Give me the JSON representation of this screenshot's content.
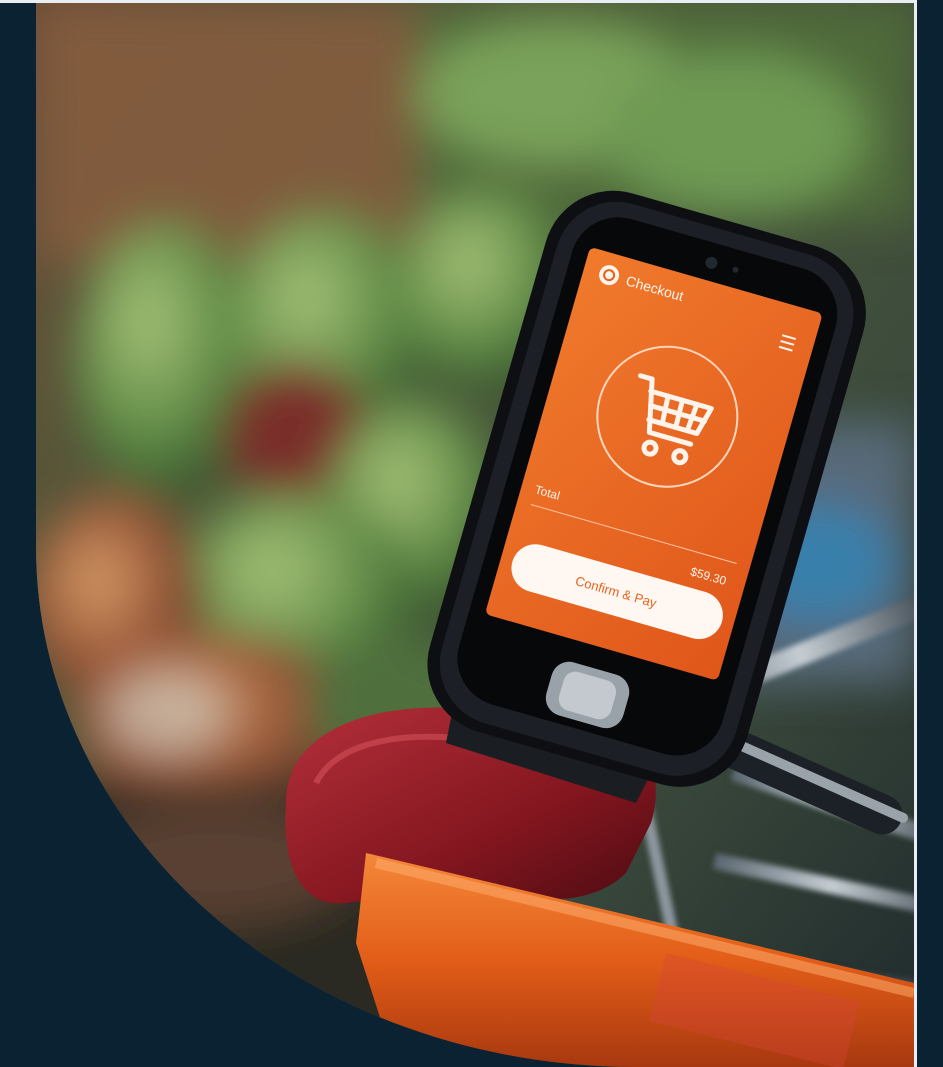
{
  "device": {
    "screen_title": "Checkout",
    "total_label": "Total",
    "total_amount": "$59.30",
    "pay_button": "Confirm & Pay",
    "icons": [
      "coin-icon",
      "menu-icon",
      "shopping-cart-icon"
    ]
  },
  "colors": {
    "background": "#0b2233",
    "screen_orange": "#e8621c",
    "handle_orange": "#e9651d",
    "clamp_red": "#8d1b22"
  }
}
